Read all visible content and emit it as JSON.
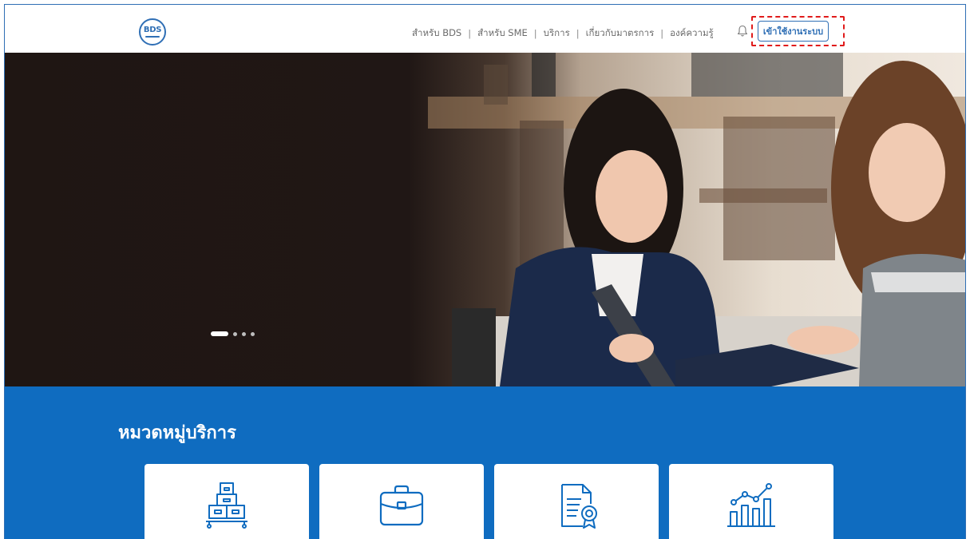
{
  "header": {
    "logo_text": "BDS",
    "nav": [
      {
        "label": "สำหรับ BDS"
      },
      {
        "label": "สำหรับ SME"
      },
      {
        "label": "บริการ"
      },
      {
        "label": "เกี่ยวกับมาตรการ"
      },
      {
        "label": "องค์ความรู้"
      }
    ],
    "nav_separator": "|",
    "bell_icon": "bell-icon",
    "login_label": "เข้าใช้งานระบบ"
  },
  "hero": {
    "carousel": {
      "total_slides": 4,
      "active_slide": 1
    }
  },
  "services": {
    "title": "หมวดหมู่บริการ",
    "categories": [
      {
        "icon": "warehouse-boxes-icon"
      },
      {
        "icon": "briefcase-icon"
      },
      {
        "icon": "certificate-document-icon"
      },
      {
        "icon": "growth-chart-icon"
      }
    ]
  },
  "colors": {
    "brand_blue": "#0f6cc0",
    "accent_outline": "#2f6fb5",
    "highlight_red": "#e01b1b"
  }
}
